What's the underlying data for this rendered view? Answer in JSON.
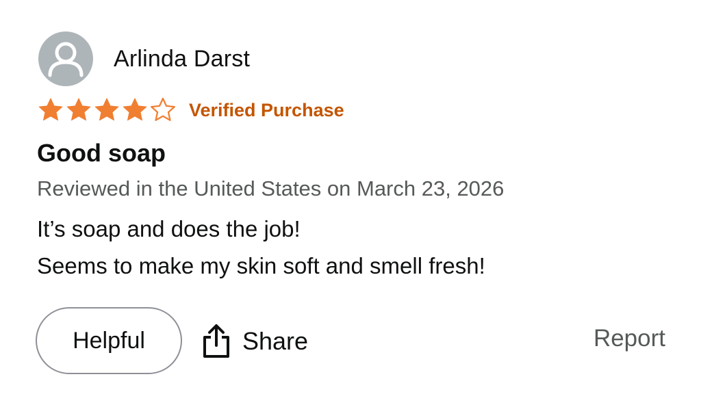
{
  "review": {
    "author_name": "Arlinda Darst",
    "avatar_icon": "user-avatar-icon",
    "rating": 4,
    "rating_max": 5,
    "star_color": "#f07f32",
    "verified_label": "Verified Purchase",
    "verified_color": "#c45500",
    "title": "Good soap",
    "meta": "Reviewed in the United States on March 23, 2026",
    "body_lines": [
      "It’s soap and does the job!",
      "Seems to make my skin soft and smell fresh!"
    ]
  },
  "actions": {
    "helpful_label": "Helpful",
    "share_label": "Share",
    "share_icon": "share-icon",
    "report_label": "Report"
  }
}
